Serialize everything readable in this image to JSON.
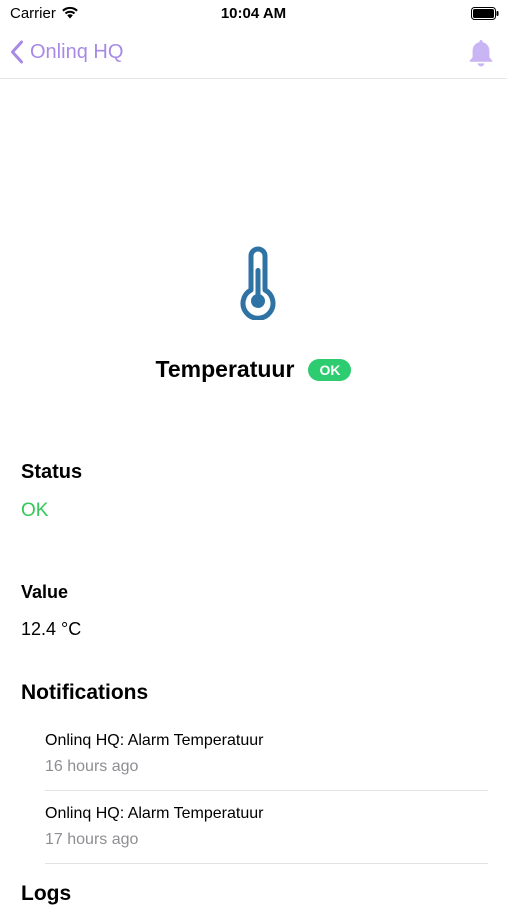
{
  "status_bar": {
    "carrier": "Carrier",
    "time": "10:04 AM",
    "wifi_icon": "wifi-icon",
    "battery_icon": "battery-icon"
  },
  "nav": {
    "back_label": "Onlinq HQ",
    "back_icon": "chevron-left-icon",
    "bell_icon": "bell-icon",
    "accent_color": "#a88ae6"
  },
  "sensor": {
    "icon": "thermometer-icon",
    "icon_color": "#2f73a5",
    "title": "Temperatuur",
    "badge": "OK",
    "badge_color": "#2ecc71"
  },
  "status": {
    "label": "Status",
    "value": "OK",
    "value_color": "#34c759"
  },
  "value": {
    "label": "Value",
    "value": "12.4 °C"
  },
  "notifications": {
    "label": "Notifications",
    "items": [
      {
        "title": "Onlinq HQ: Alarm Temperatuur",
        "time": "16 hours ago"
      },
      {
        "title": "Onlinq HQ: Alarm Temperatuur",
        "time": "17 hours ago"
      }
    ]
  },
  "logs": {
    "label": "Logs"
  }
}
